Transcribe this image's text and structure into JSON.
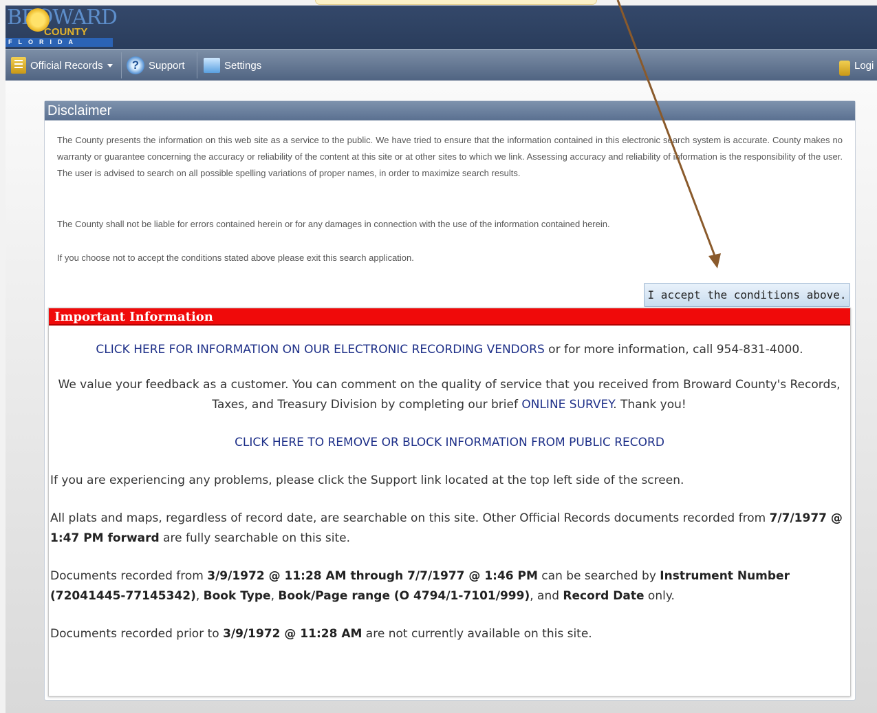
{
  "header": {
    "logo": {
      "word": "BROWARD",
      "county": "COUNTY",
      "state": "FLORIDA"
    },
    "nav": {
      "official_records": "Official Records",
      "support": "Support",
      "settings": "Settings",
      "login": "Logi"
    }
  },
  "disclaimer": {
    "title": "Disclaimer",
    "para1": "The County presents the information on this web site as a service to the public. We have tried to ensure that the information contained in this electronic search system is accurate. County makes no warranty or guarantee concerning the accuracy or reliability of the content at this site or at other sites to which we link. Assessing accuracy and reliability of information is the responsibility of the user. The user is advised to search on all possible spelling variations of proper names, in order to maximize search results.",
    "para2": "The County shall not be liable for errors contained herein or for any damages in connection with the use of the information contained herein.",
    "para3": "If you choose not to accept the conditions stated above please exit this search application.",
    "accept_label": "I accept the conditions above."
  },
  "important": {
    "title": "Important Information",
    "vendors_link": "CLICK HERE FOR INFORMATION ON OUR ELECTRONIC RECORDING VENDORS",
    "vendors_rest": " or for more information, call 954-831-4000.",
    "feedback_pre": "We value your feedback as a customer. You can comment on the quality of service that you received from Broward County's Records, Taxes, and Treasury Division by completing our brief ",
    "survey_link": "ONLINE SURVEY",
    "feedback_post": ". Thank you!",
    "remove_link": "CLICK HERE TO REMOVE OR BLOCK INFORMATION FROM PUBLIC RECORD",
    "problems": "If you are experiencing any problems, please click the Support link located at the top left side of the screen.",
    "plats_pre": "All plats and maps, regardless of record date, are searchable on this site. Other Official Records documents recorded from ",
    "plats_bold": "7/7/1977 @ 1:47 PM forward",
    "plats_post": " are fully searchable on this site.",
    "docs_1": "Documents recorded from ",
    "docs_b1": "3/9/1972 @ 11:28 AM through 7/7/1977 @ 1:46 PM",
    "docs_2": " can be searched by ",
    "docs_b2": "Instrument Number (72041445-77145342)",
    "docs_3": ", ",
    "docs_b3": "Book Type",
    "docs_4": ", ",
    "docs_b4": "Book/Page range (O 4794/1-7101/999)",
    "docs_5": ", and ",
    "docs_b5": "Record Date",
    "docs_6": " only.",
    "prior_pre": "Documents recorded prior to ",
    "prior_bold": "3/9/1972 @ 11:28 AM",
    "prior_post": " are not currently available on this site."
  },
  "colors": {
    "header_bg": "#2f4263",
    "important_red": "#f00a0a",
    "link_blue": "#1d2f88",
    "annotation_arrow": "#8a5a2b"
  }
}
